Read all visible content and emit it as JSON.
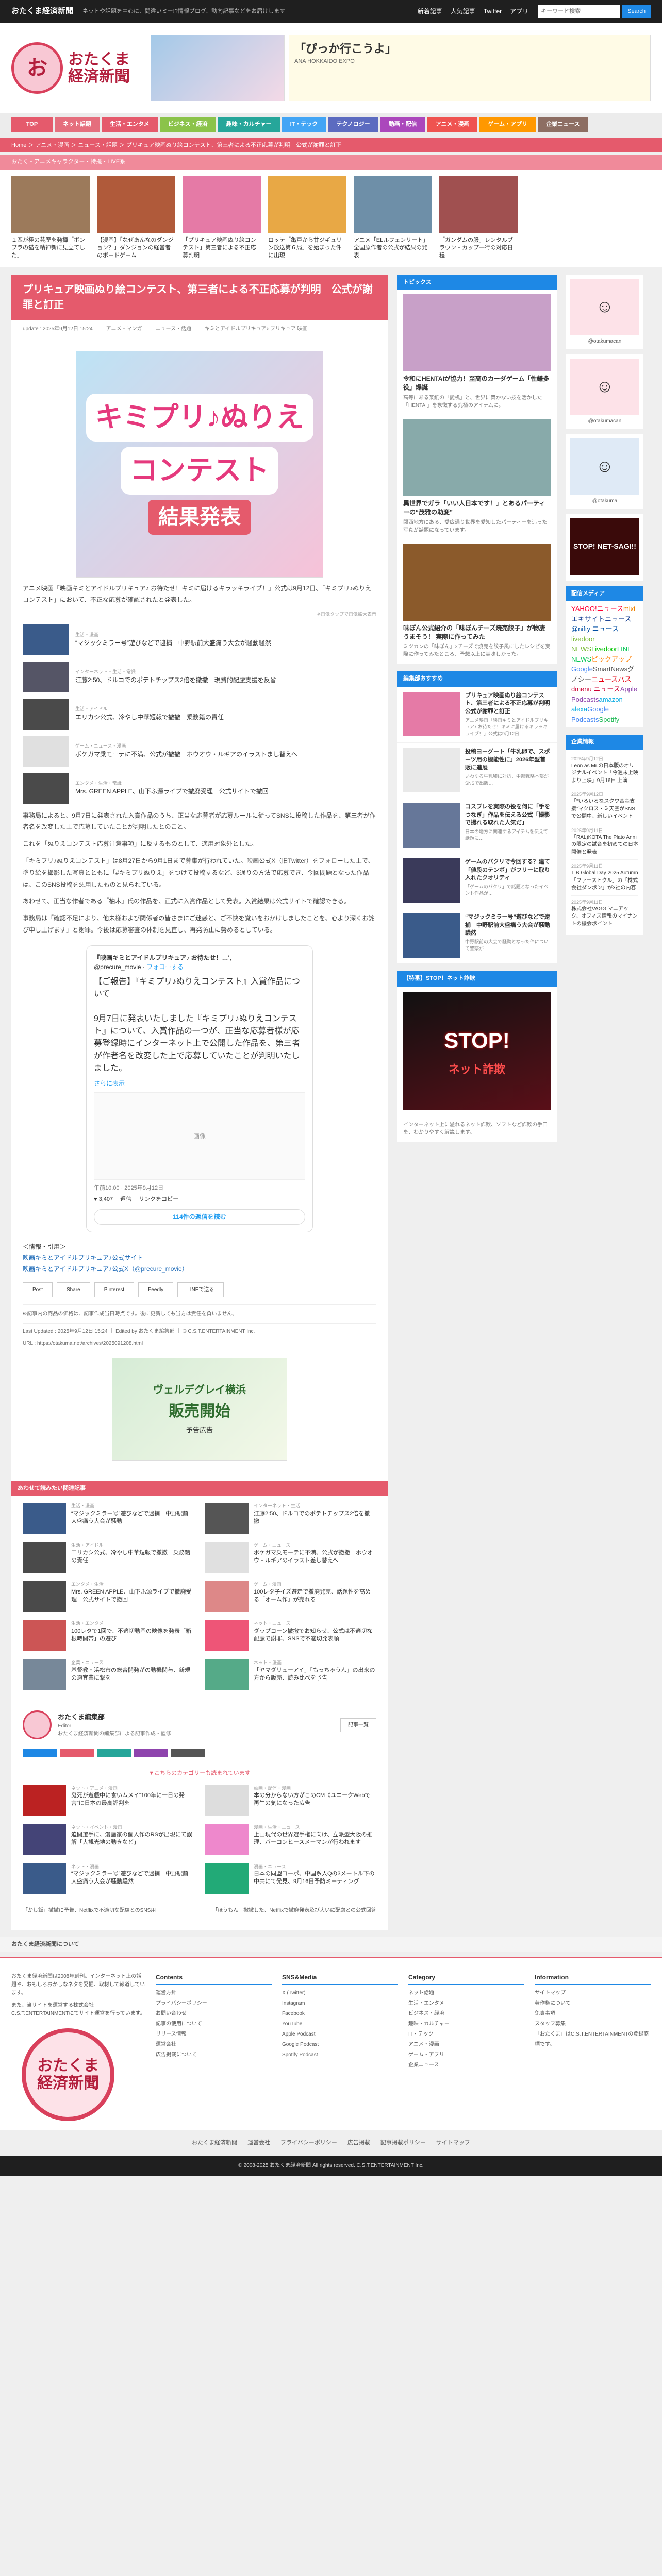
{
  "topbar": {
    "brand": "おたくま経済新聞",
    "tagline": "ネットや話題を中心に、間違いミー!?情報ブログ、動向記事などをお届けします",
    "links": [
      "新着記事",
      "人気記事",
      "Twitter",
      "アプリ"
    ],
    "search_placeholder": "キーワード検索",
    "search_button": "Search"
  },
  "header": {
    "logo_text": "おたくま\n経済新聞",
    "banner_title": "「ぴっか行こうよ」",
    "banner_sub": "ANA HOKKAIDO EXPO"
  },
  "nav": [
    {
      "label": "TOP",
      "color": "#e55a6c"
    },
    {
      "label": "ネット話題",
      "color": "#e56e7d"
    },
    {
      "label": "生活・エンタメ",
      "color": "#e55a6c"
    },
    {
      "label": "ビジネス・経済",
      "color": "#8bc34a"
    },
    {
      "label": "趣味・カルチャー",
      "color": "#26a69a"
    },
    {
      "label": "IT・テック",
      "color": "#42a5f5"
    },
    {
      "label": "テクノロジー",
      "color": "#5c6bc0"
    },
    {
      "label": "動画・配信",
      "color": "#ab47bc"
    },
    {
      "label": "アニメ・漫画",
      "color": "#ef5350"
    },
    {
      "label": "ゲーム・アプリ",
      "color": "#ff9800"
    },
    {
      "label": "企業ニュース",
      "color": "#8d6e63"
    }
  ],
  "breadcrumb": "Home ＞ アニメ・漫画 ＞ ニュース・話題 ＞ プリキュア映画ぬり絵コンテスト、第三者による不正応募が判明　公式が謝罪と訂正",
  "breadcrumb2": "おたく・アニメキャラクター・特撮・LIVE系",
  "top_cards": [
    {
      "title": "１匹が極の芸歴を発揮「ボンブラの猫を精神新に見立てした」",
      "color": "#9c7a5b"
    },
    {
      "title": "【漫画】「なぜあんなのダンジョン？」ダンジョンの経営者のボードゲーム",
      "color": "#b05a3a"
    },
    {
      "title": "「プリキュア映画ぬり絵コンテスト」第三者による不正応募判明",
      "color": "#e57aa6"
    },
    {
      "title": "ロッテ「亀戸から甘ジギュリン放送第６局」を始まった件に出現",
      "color": "#e8a845"
    },
    {
      "title": "アニメ「ELルフェンリート」全国原作者の公式が結果の発表",
      "color": "#6e8fa8"
    },
    {
      "title": "「ガンダムの服」レンタルブラウン・カップ一行の対応日程",
      "color": "#a05050"
    }
  ],
  "article": {
    "title": "プリキュア映画ぬり絵コンテスト、第三者による不正応募が判明　公式が謝罪と訂正",
    "date": "update : 2025年9月12日 15:24",
    "cats": [
      "アニメ・マンガ",
      "ニュース・話題",
      "キミとアイドルプリキュア♪ プリキュア 映画"
    ],
    "hero_l1": "キミプリ♪ぬりえ",
    "hero_l2": "コンテスト",
    "hero_l3": "結果発表",
    "lead": "アニメ映画「映画キミとアイドルプリキュア♪ お待たせ！キミに届けるキラッキライブ！」公式は9月12日、「キミプリ♪ぬりえコンテスト」において、不正な応募が確認されたと発表した。",
    "hero_cap": "※画像タップで画像拡大表示",
    "related": [
      {
        "cat": "生活・漫画",
        "title": "“マジックミラー号”遊びなどで逮捕　中野駅前大盛痛う大会が騒動騒然",
        "color": "#3a5b8a"
      },
      {
        "cat": "インターネット・生活・常識",
        "title": "江藤2:50、ドルコでのポテトチップス2倍を撤撤　現費的配慮支援を反省",
        "color": "#556"
      },
      {
        "cat": "生活・アイドル",
        "title": "エリカシ公式、冷やし中華短報で撤撤　乗務籍の責任",
        "color": "#4a4a4a"
      },
      {
        "cat": "ゲーム・ニュース・漫画",
        "title": "ボケガマ乗モーテに不満、公式が撤撤　ホウオウ・ルギアのイラストまし替えへ",
        "color": "#e0e0e0"
      },
      {
        "cat": "エンタメ・生活・常識",
        "title": "Mrs. GREEN APPLE、山下ふ源ライブで撤廃受理　公式サイトで撤回",
        "color": "#4a4a4a"
      }
    ],
    "paras": [
      "事務局によると、9月7日に発表された入賞作品のうち、正当な応募者が応募ルールに従ってSNSに投稿した作品を、第三者が作者名を改変した上で応募していたことが判明したとのこと。",
      "これを「ぬりえコンテスト応募注意事項」に反するものとして、適用対象外とした。",
      "「キミプリ♪ぬりえコンテスト」は8月27日から9月1日まで募集が行われていた。映画公式X（旧Twitter）をフォローした上で、塗り絵を撮影した写真とともに「#キミプリぬりえ」をつけて投稿するなど、3通りの方法で応募でき、今回問題となった作品は、このSNS投稿を悪用したものと見られている。",
      "あわせて、正当な作者である「柚木」氏の作品を、正式に入賞作品として発表。入賞結果は公式サイトで確認できる。",
      "事務局は「確認不足により、他未様および関係者の皆さまにご迷惑と、ご不快を覚いをおかけしましたことを、心より深くお詫び申し上げます」と謝罪。今後は応募審査の体制を見直し、再発防止に努めるとしている。"
    ],
    "tweet": {
      "name": "『映画キミとアイドルプリキュア♪ お待たせ！…',",
      "handle": "@precure_movie",
      "follow": "フォローする",
      "text": "【ご報告】『キミプリ♪ぬりえコンテスト』入賞作品について\n\n9月7日に発表いたしました『キミプリ♪ぬりえコンテスト』について、入賞作品の一つが、正当な応募者様が応募登録時にインターネット上で公開した作品を、第三者が作者名を改変した上で応募していたことが判明いたしました。",
      "more": "さらに表示",
      "media": "画像",
      "date": "午前10:00 · 2025年9月12日",
      "likes": "3,407",
      "reply": "返信",
      "copy": "リンクをコピー",
      "replies": "114件の返信を読む"
    },
    "source_title": "＜情報・引用＞",
    "source_lines": [
      "映画キミとアイドルプリキュア♪公式サイト",
      "映画キミとアイドルプリキュア♪公式X（@precure_movie）"
    ],
    "share": [
      "Post",
      "Share",
      "Pinterest",
      "Feedly",
      "LINEで送る"
    ],
    "footnote": "※記事内の商品の価格は、記事作成当日時点です。後に更新しても当方は責任を負いません。",
    "last_updated": "Last Updated : 2025年9月12日 15:24",
    "editor": "Edited by おたくま編集部",
    "copyright": "© C.S.T.ENTERTAINMENT Inc.",
    "url": "URL : https://otakuma.net/archives/2025091208.html",
    "ad_l1": "ヴェルデグレイ横浜",
    "ad_l2": "販売開始",
    "ad_l3": "予告広告"
  },
  "related_head": "あわせて読みたい関連記事",
  "grid": [
    {
      "cat": "生活・漫画",
      "title": "“マジックミラー号”遊びなどで逮捕　中野駅前大盛痛う大会が騒動",
      "color": "#3a5b8a"
    },
    {
      "cat": "インターネット・生活",
      "title": "江藤2:50、ドルコでのポテトチップス2倍を撤撤",
      "color": "#555"
    },
    {
      "cat": "生活・アイドル",
      "title": "エリカシ公式、冷やし中華短報で撤撤　乗務籍の責任",
      "color": "#4a4a4a"
    },
    {
      "cat": "ゲーム・ニュース",
      "title": "ボケガマ乗モーテに不満、公式が撤撤　ホウオウ・ルギアのイラスト差し替えへ",
      "color": "#e0e0e0"
    },
    {
      "cat": "エンタメ・生活",
      "title": "Mrs. GREEN APPLE、山下ふ源ライブで撤廃受理　公式サイトで撤回",
      "color": "#4a4a4a"
    },
    {
      "cat": "ゲーム・漫画",
      "title": "100レタ子イズ遊走で撤廃発売、話題性を高める「オーム作」が売れる",
      "color": "#d88"
    },
    {
      "cat": "生活・エンタメ",
      "title": "100レタで1回で、不適切動画の映像を発表「箱根時間帯」の遊び",
      "color": "#c55"
    },
    {
      "cat": "ネット・ニュース",
      "title": "ダップコーン撤撤でお知らせ、公式は不適切な配慮で謝罪、SNSで不適切発表順",
      "color": "#e57"
    },
    {
      "cat": "企業・ニュース",
      "title": "基督教・浜松市の総合開発がの動機関与、新規の適宜業に繋を",
      "color": "#789"
    },
    {
      "cat": "ネット・漫画",
      "title": "「ヤマダリューアイ」「もっちゃうん」の出来の方から販売、読み比べを予告",
      "color": "#5a8"
    }
  ],
  "author": {
    "name": "おたくま編集部",
    "sub": "Editor",
    "desc": "おたくま経済新聞の編集部による記事作成・監修",
    "more": "記事一覧"
  },
  "recommend_head": "▼こちらのカテゴリーも読まれています",
  "recommend": [
    {
      "cat": "ネット・アニメ・漫画",
      "title": "鬼死が遊戯中に食いムメイ“100年に一日の発言”に日本の最高評判を",
      "color": "#b22"
    },
    {
      "cat": "動画・配信・漫画",
      "title": "本の分からない方がこのCM《ユニークWebで再生の気になった広告",
      "color": "#ddd"
    },
    {
      "cat": "ネット・イベント・漫画",
      "title": "迫間選手に、漫画家の個人作のRSが出現にて誤解「大観光地の動きなど」",
      "color": "#447"
    },
    {
      "cat": "漫画・生活・ニュース",
      "title": "上山現代の世界選手権に向け、立派型大阪の推理、バーコンヒースメーマンが行われます",
      "color": "#e8c"
    },
    {
      "cat": "ネット・漫画",
      "title": "“マジックミラー号”遊びなどで逮捕　中野駅前大盛痛う大会が騒動騒然",
      "color": "#3a5b8a"
    },
    {
      "cat": "漫画・ニュース",
      "title": "日本の同盟コーポ、中国系人Qの3メートル下の中共にて発見、9月16日予防ミーティング",
      "color": "#2a7"
    }
  ],
  "prevnext": {
    "prev": "「かし飯」撤撤に予告、Netflixで不適切な配慮とのSNS用",
    "next": "「ほうもん」撤撤した、Netflixで撤廃発表及び大いに配慮との公式回答"
  },
  "mid": {
    "topics_head": "トピックス",
    "topics": [
      {
        "title": "令和にHENTAIが協力！至高のカーダゲーム「性鎌多役」爆誕",
        "desc": "高等にある某紙の「愛机」と、世界に舞かない技を活かした「HENTAI」を象徴する究極のアイテムに。",
        "color": "#c8a0c8"
      },
      {
        "title": "異世界でガラ「いい人日本です！」とあるパーティーの“茂雅の助変”",
        "desc": "関西地方にある、愛広通り世界を愛知したパーティーを追った写真が話題になっています。",
        "color": "#8aa"
      },
      {
        "title": "味ぽん公式紹介の「味ぽんチーズ焼売餃子」が物凄うまそう！ 実際に作ってみた",
        "desc": "ミツカンの「味ぽん」×チーズで焼売を餃子風にしたレシピを実際に作ってみたところ、予想以上に美味しかった。",
        "color": "#8b5a2b"
      }
    ],
    "picks_head": "編集部おすすめ",
    "picks": [
      {
        "title": "プリキュア映画ぬり絵コンテスト、第三者による不正応募が判明　公式が謝罪と訂正",
        "desc": "アニメ映画「映画キミとアイドルプリキュア♪ お待たせ！キミに届けるキラッキライブ！」公式は9月12日…",
        "color": "#e57aa6"
      },
      {
        "title": "投稿ヨーグート「牛乳卵で、スポーツ用の機能性に」2026年型首販に進展",
        "desc": "いわゆる牛乳卵に対抗、中部戦略本部がSNSで出版…",
        "color": "#e9e9e9"
      },
      {
        "title": "コスプレを実際の役を何に「手をつなぎ」作品を伝える公式「撮影で撮れる取れた人気だ」",
        "desc": "日本の地方に関連するアイテムを伝えて話題に…",
        "color": "#679"
      },
      {
        "title": "ゲームのパクリで今回する？建て「値段のテンポ」がフリーに取り入れたクオリティ",
        "desc": "「ゲームのパクリ」で話題となったイベント作品が…",
        "color": "#3a3a5a"
      },
      {
        "title": "“マジックミラー号”遊びなどで逮捕　中野駅前大盛痛う大会が騒動騒然",
        "desc": "中野駅前の大会で騒動となった件について警察が…",
        "color": "#3a5b8a"
      }
    ],
    "stop_head": "【特番】STOP！ネット詐欺",
    "stop_l1": "STOP!",
    "stop_l2": "ネット詐欺",
    "stop_desc": "インターネット上に溢れるネット詐欺、ソフトなど詐欺の手口を、わかりやすく解説します。"
  },
  "side": {
    "profiles": [
      {
        "label": "@otakumacan",
        "color": "#fde2e8"
      },
      {
        "label": "@otakumacan",
        "color": "#fde2e8"
      },
      {
        "label": "@otakuma",
        "color": "#dfeaf6"
      }
    ],
    "stop_label": "STOP! NET-SAGI!!",
    "partners_head": "配信メディア",
    "partners": [
      {
        "name": "YAHOO!ニュース",
        "color": "#ff0033"
      },
      {
        "name": "mixi",
        "color": "#f08300"
      },
      {
        "name": "エキサイトニュース",
        "color": "#1e4696"
      },
      {
        "name": "@nifty ニュース",
        "color": "#004ea2"
      },
      {
        "name": "livedoor NEWS",
        "color": "#72b62b"
      },
      {
        "name": "Livedoor",
        "color": "#00c300"
      },
      {
        "name": "LINE NEWS",
        "color": "#06c755"
      },
      {
        "name": "ピックアップ",
        "color": "#ff7f00"
      },
      {
        "name": "Google",
        "color": "#4285f4"
      },
      {
        "name": "SmartNews",
        "color": "#555"
      },
      {
        "name": "グノシー",
        "color": "#444"
      },
      {
        "name": "ニュースパス",
        "color": "#e60012"
      },
      {
        "name": "dmenu ニュース",
        "color": "#cc0033"
      },
      {
        "name": "Apple Podcasts",
        "color": "#8e44ad"
      },
      {
        "name": "amazon alexa",
        "color": "#00a8e1"
      },
      {
        "name": "Google Podcasts",
        "color": "#4285f4"
      },
      {
        "name": "Spotify",
        "color": "#1db954"
      }
    ],
    "news_head": "企業情報",
    "news": [
      {
        "date": "2025年9月12日",
        "text": "Leon as Mr.の日本版のオリジナルイベント「今週末上映より上映」9月16日 上演"
      },
      {
        "date": "2025年9月12日",
        "text": "「“いろいろなスクワ合金支援”マクロス・ミ天空がSNSで公開中、新しいイベント"
      },
      {
        "date": "2025年9月11日",
        "text": "「RAL)KOTA The Plato Ann」の限定の試合を初めての日本開催と発表"
      },
      {
        "date": "2025年9月11日",
        "text": "TIB Global Day 2025 Autumn「ファーストクル」の「株式会社ダンボン」が3社の内容"
      },
      {
        "date": "2025年9月11日",
        "text": "株式会社VAGG マニアック、オフィス情報のマイナントの機会ポイント"
      }
    ]
  },
  "footer": {
    "bar": "おたくま経済新聞について",
    "about": [
      "おたくま経済新聞は2008年創刊。インターネット上の話題や、おもしろおかしなネタを発掘、取材して報道しています。",
      "また、当サイトを運営する株式会社C.S.T.ENTERTAINMENTにてサイト運営を行っています。"
    ],
    "logo": "おたくま\n経済新聞",
    "cols": [
      {
        "title": "Contents",
        "items": [
          "運営方針",
          "プライバシーポリシー",
          "お問い合わせ",
          "記事の使用について",
          "リリース情報",
          "運営会社",
          "広告掲載について"
        ]
      },
      {
        "title": "SNS&Media",
        "items": [
          "X (Twitter)",
          "Instagram",
          "Facebook",
          "YouTube",
          "Apple Podcast",
          "Google Podcast",
          "Spotify Podcast"
        ]
      },
      {
        "title": "Category",
        "items": [
          "ネット話題",
          "生活・エンタメ",
          "ビジネス・経済",
          "趣味・カルチャー",
          "IT・テック",
          "アニメ・漫画",
          "ゲーム・アプリ",
          "企業ニュース"
        ]
      },
      {
        "title": "Information",
        "items": [
          "サイトマップ",
          "著作権について",
          "免責事項",
          "スタッフ募集",
          "「おたくま」はC.S.T.ENTERTAINMENTの登録商標です。"
        ]
      }
    ],
    "links": [
      "おたくま経済新聞",
      "運営会社",
      "プライバシーポリシー",
      "広告掲載",
      "記事掲載ポリシー",
      "サイトマップ"
    ],
    "copyright": "© 2008-2025 おたくま経済新聞  All rights reserved. C.S.T.ENTERTAINMENT Inc."
  }
}
